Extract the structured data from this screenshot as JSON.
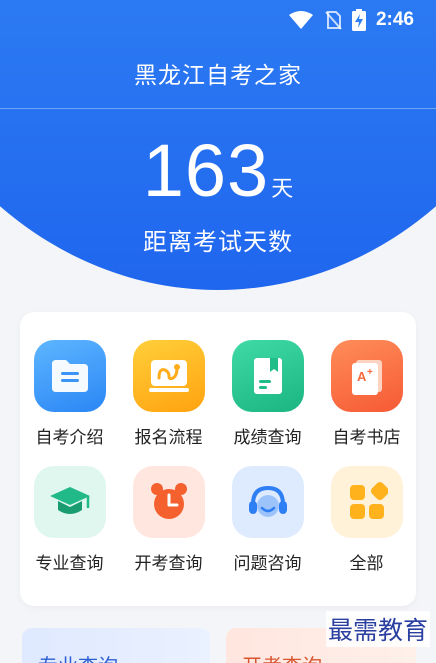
{
  "status_bar": {
    "time": "2:46"
  },
  "header": {
    "title": "黑龙江自考之家"
  },
  "countdown": {
    "number": "163",
    "unit": "天",
    "label": "距离考试天数"
  },
  "menu": {
    "items": [
      {
        "label": "自考介绍",
        "icon": "folder-icon"
      },
      {
        "label": "报名流程",
        "icon": "route-icon"
      },
      {
        "label": "成绩查询",
        "icon": "bookmark-doc-icon"
      },
      {
        "label": "自考书店",
        "icon": "grade-book-icon"
      },
      {
        "label": "专业查询",
        "icon": "graduation-cap-icon"
      },
      {
        "label": "开考查询",
        "icon": "alarm-clock-icon"
      },
      {
        "label": "问题咨询",
        "icon": "headset-icon"
      },
      {
        "label": "全部",
        "icon": "grid-icon"
      }
    ]
  },
  "bottom_cards": {
    "left": "专业查询",
    "right": "开考查询"
  },
  "watermark": "最需教育"
}
